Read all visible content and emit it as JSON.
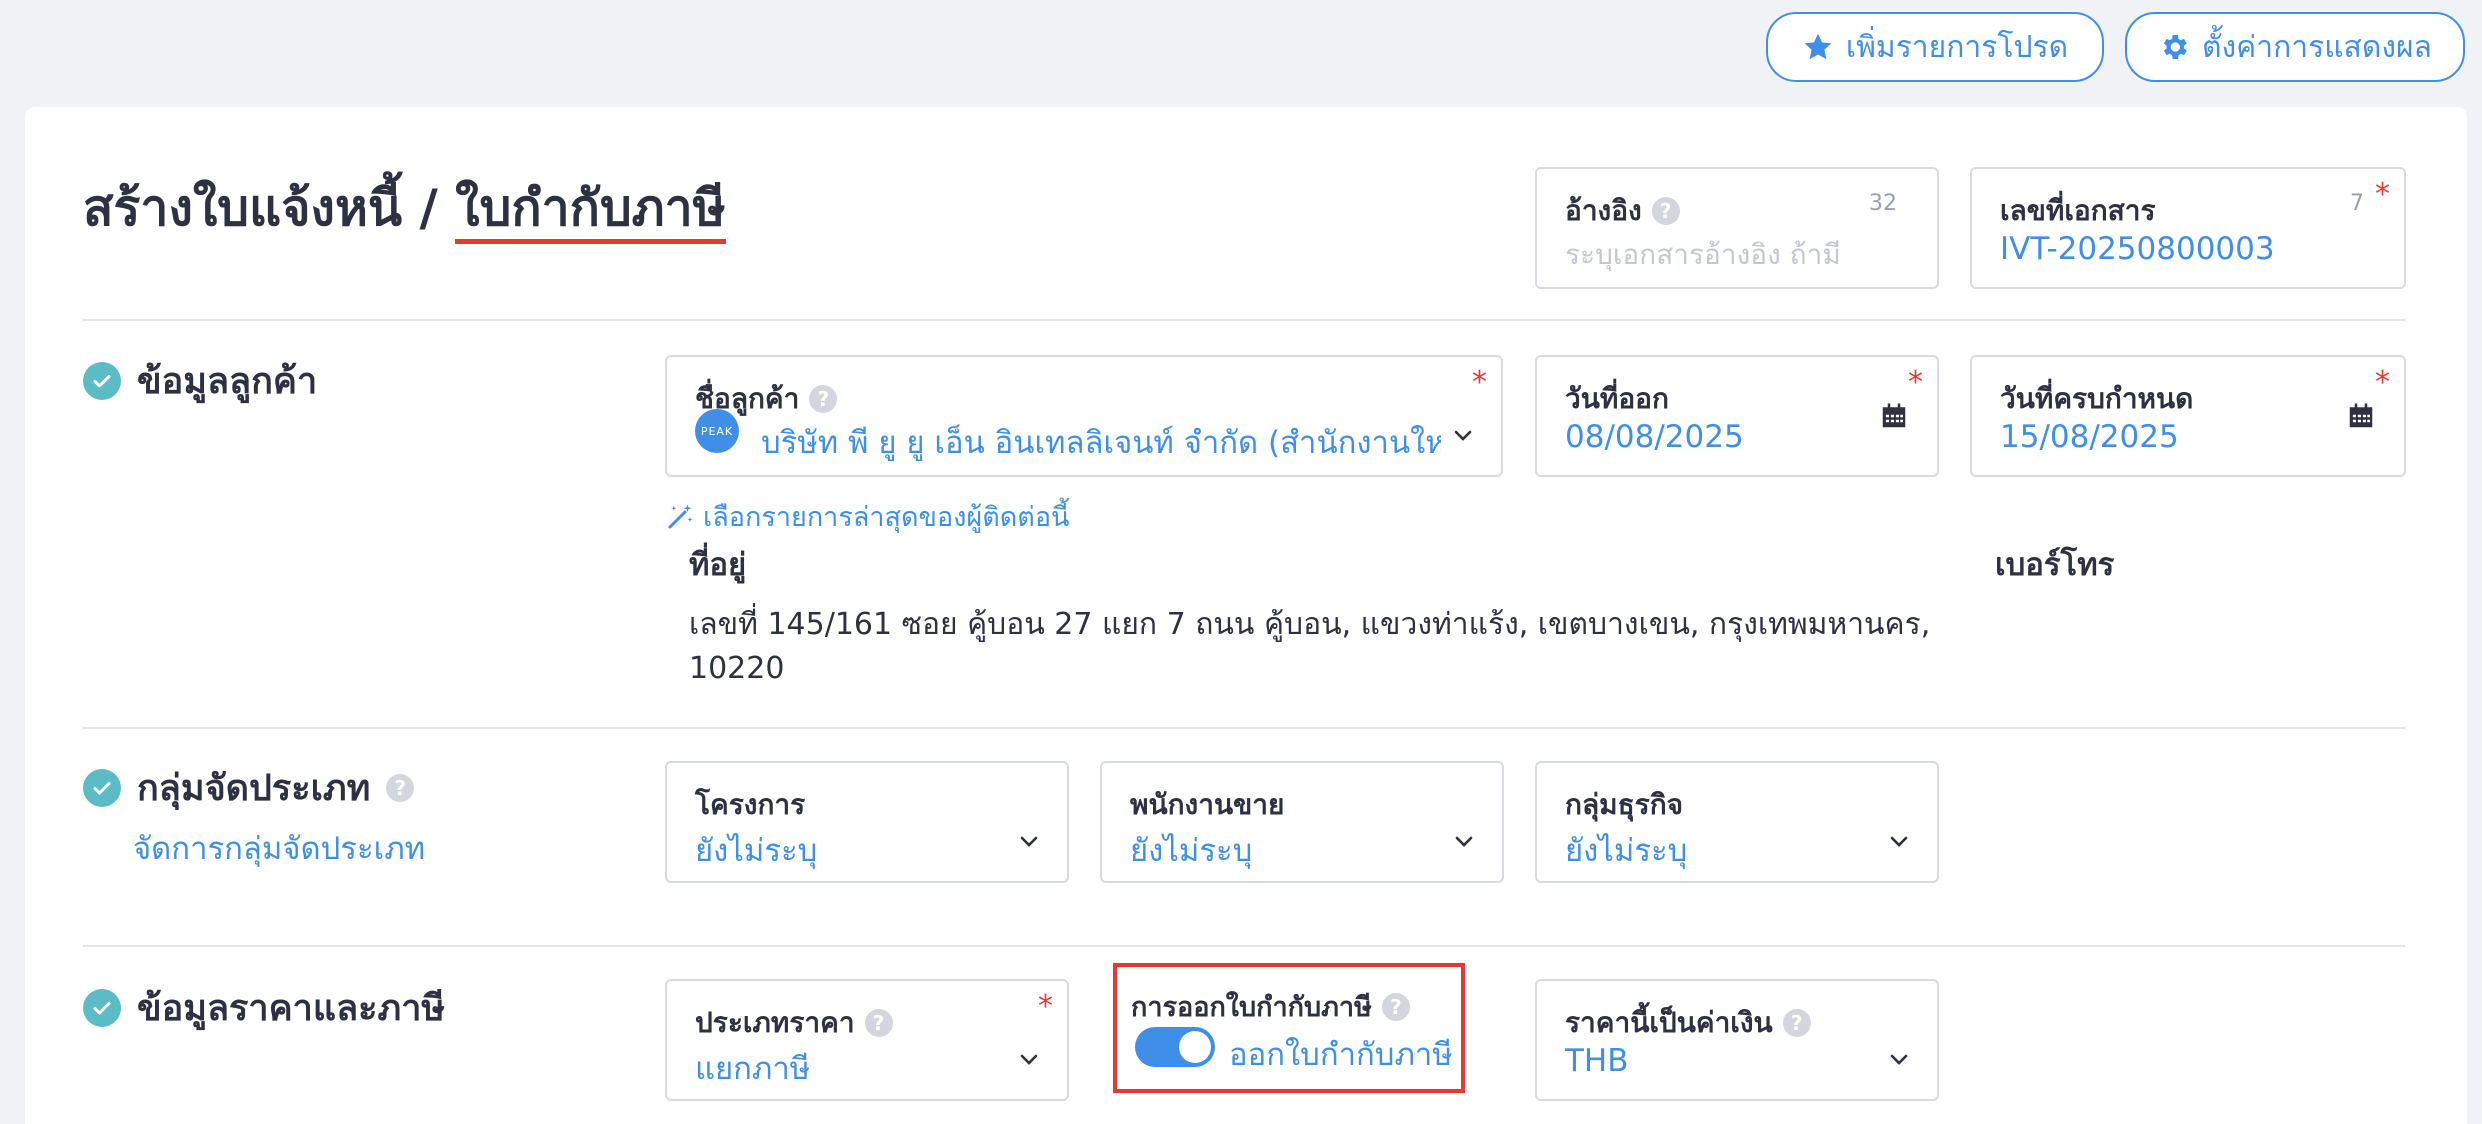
{
  "header": {
    "favorite_label": "เพิ่มรายการโปรด",
    "settings_label": "ตั้งค่าการแสดงผล"
  },
  "page": {
    "title_prefix": "สร้างใบแจ้งหนี้ / ",
    "title_highlight": "ใบกำกับภาษี"
  },
  "reference": {
    "label": "อ้างอิง",
    "counter": "32",
    "placeholder": "ระบุเอกสารอ้างอิง ถ้ามี"
  },
  "doc_number": {
    "label": "เลขที่เอกสาร",
    "counter": "7",
    "value": "IVT-20250800003"
  },
  "customer_section": {
    "title": "ข้อมูลลูกค้า",
    "customer_label": "ชื่อลูกค้า",
    "customer_value": "บริษัท พี ยู ยู เอ็น อินเทลลิเจนท์ จำกัด (สำนักงานให...",
    "avatar_text": "PEAK",
    "issue_date_label": "วันที่ออก",
    "issue_date_value": "08/08/2025",
    "due_date_label": "วันที่ครบกำหนด",
    "due_date_value": "15/08/2025",
    "recent_contact_link": "เลือกรายการล่าสุดของผู้ติดต่อนี้",
    "address_label": "ที่อยู่",
    "address_line1": "เลขที่ 145/161 ซอย คู้บอน 27 แยก 7 ถนน คู้บอน, แขวงท่าแร้ง, เขตบางเขน, กรุงเทพมหานคร,",
    "address_line2": "10220",
    "phone_label": "เบอร์โทร"
  },
  "category_section": {
    "title": "กลุ่มจัดประเภท",
    "manage_link": "จัดการกลุ่มจัดประเภท",
    "project_label": "โครงการ",
    "project_value": "ยังไม่ระบุ",
    "sales_label": "พนักงานขาย",
    "sales_value": "ยังไม่ระบุ",
    "business_label": "กลุ่มธุรกิจ",
    "business_value": "ยังไม่ระบุ"
  },
  "tax_section": {
    "title": "ข้อมูลราคาและภาษี",
    "price_type_label": "ประเภทราคา",
    "price_type_value": "แยกภาษี",
    "tax_invoice_label": "การออกใบกำกับภาษี",
    "tax_invoice_toggle_label": "ออกใบกำกับภาษี",
    "currency_label": "ราคานี้เป็นค่าเงิน",
    "currency_value": "THB"
  },
  "colors": {
    "accent": "#3f8fe8",
    "required": "#e53935",
    "check": "#5bbcc6",
    "highlight_border": "#e53935"
  }
}
